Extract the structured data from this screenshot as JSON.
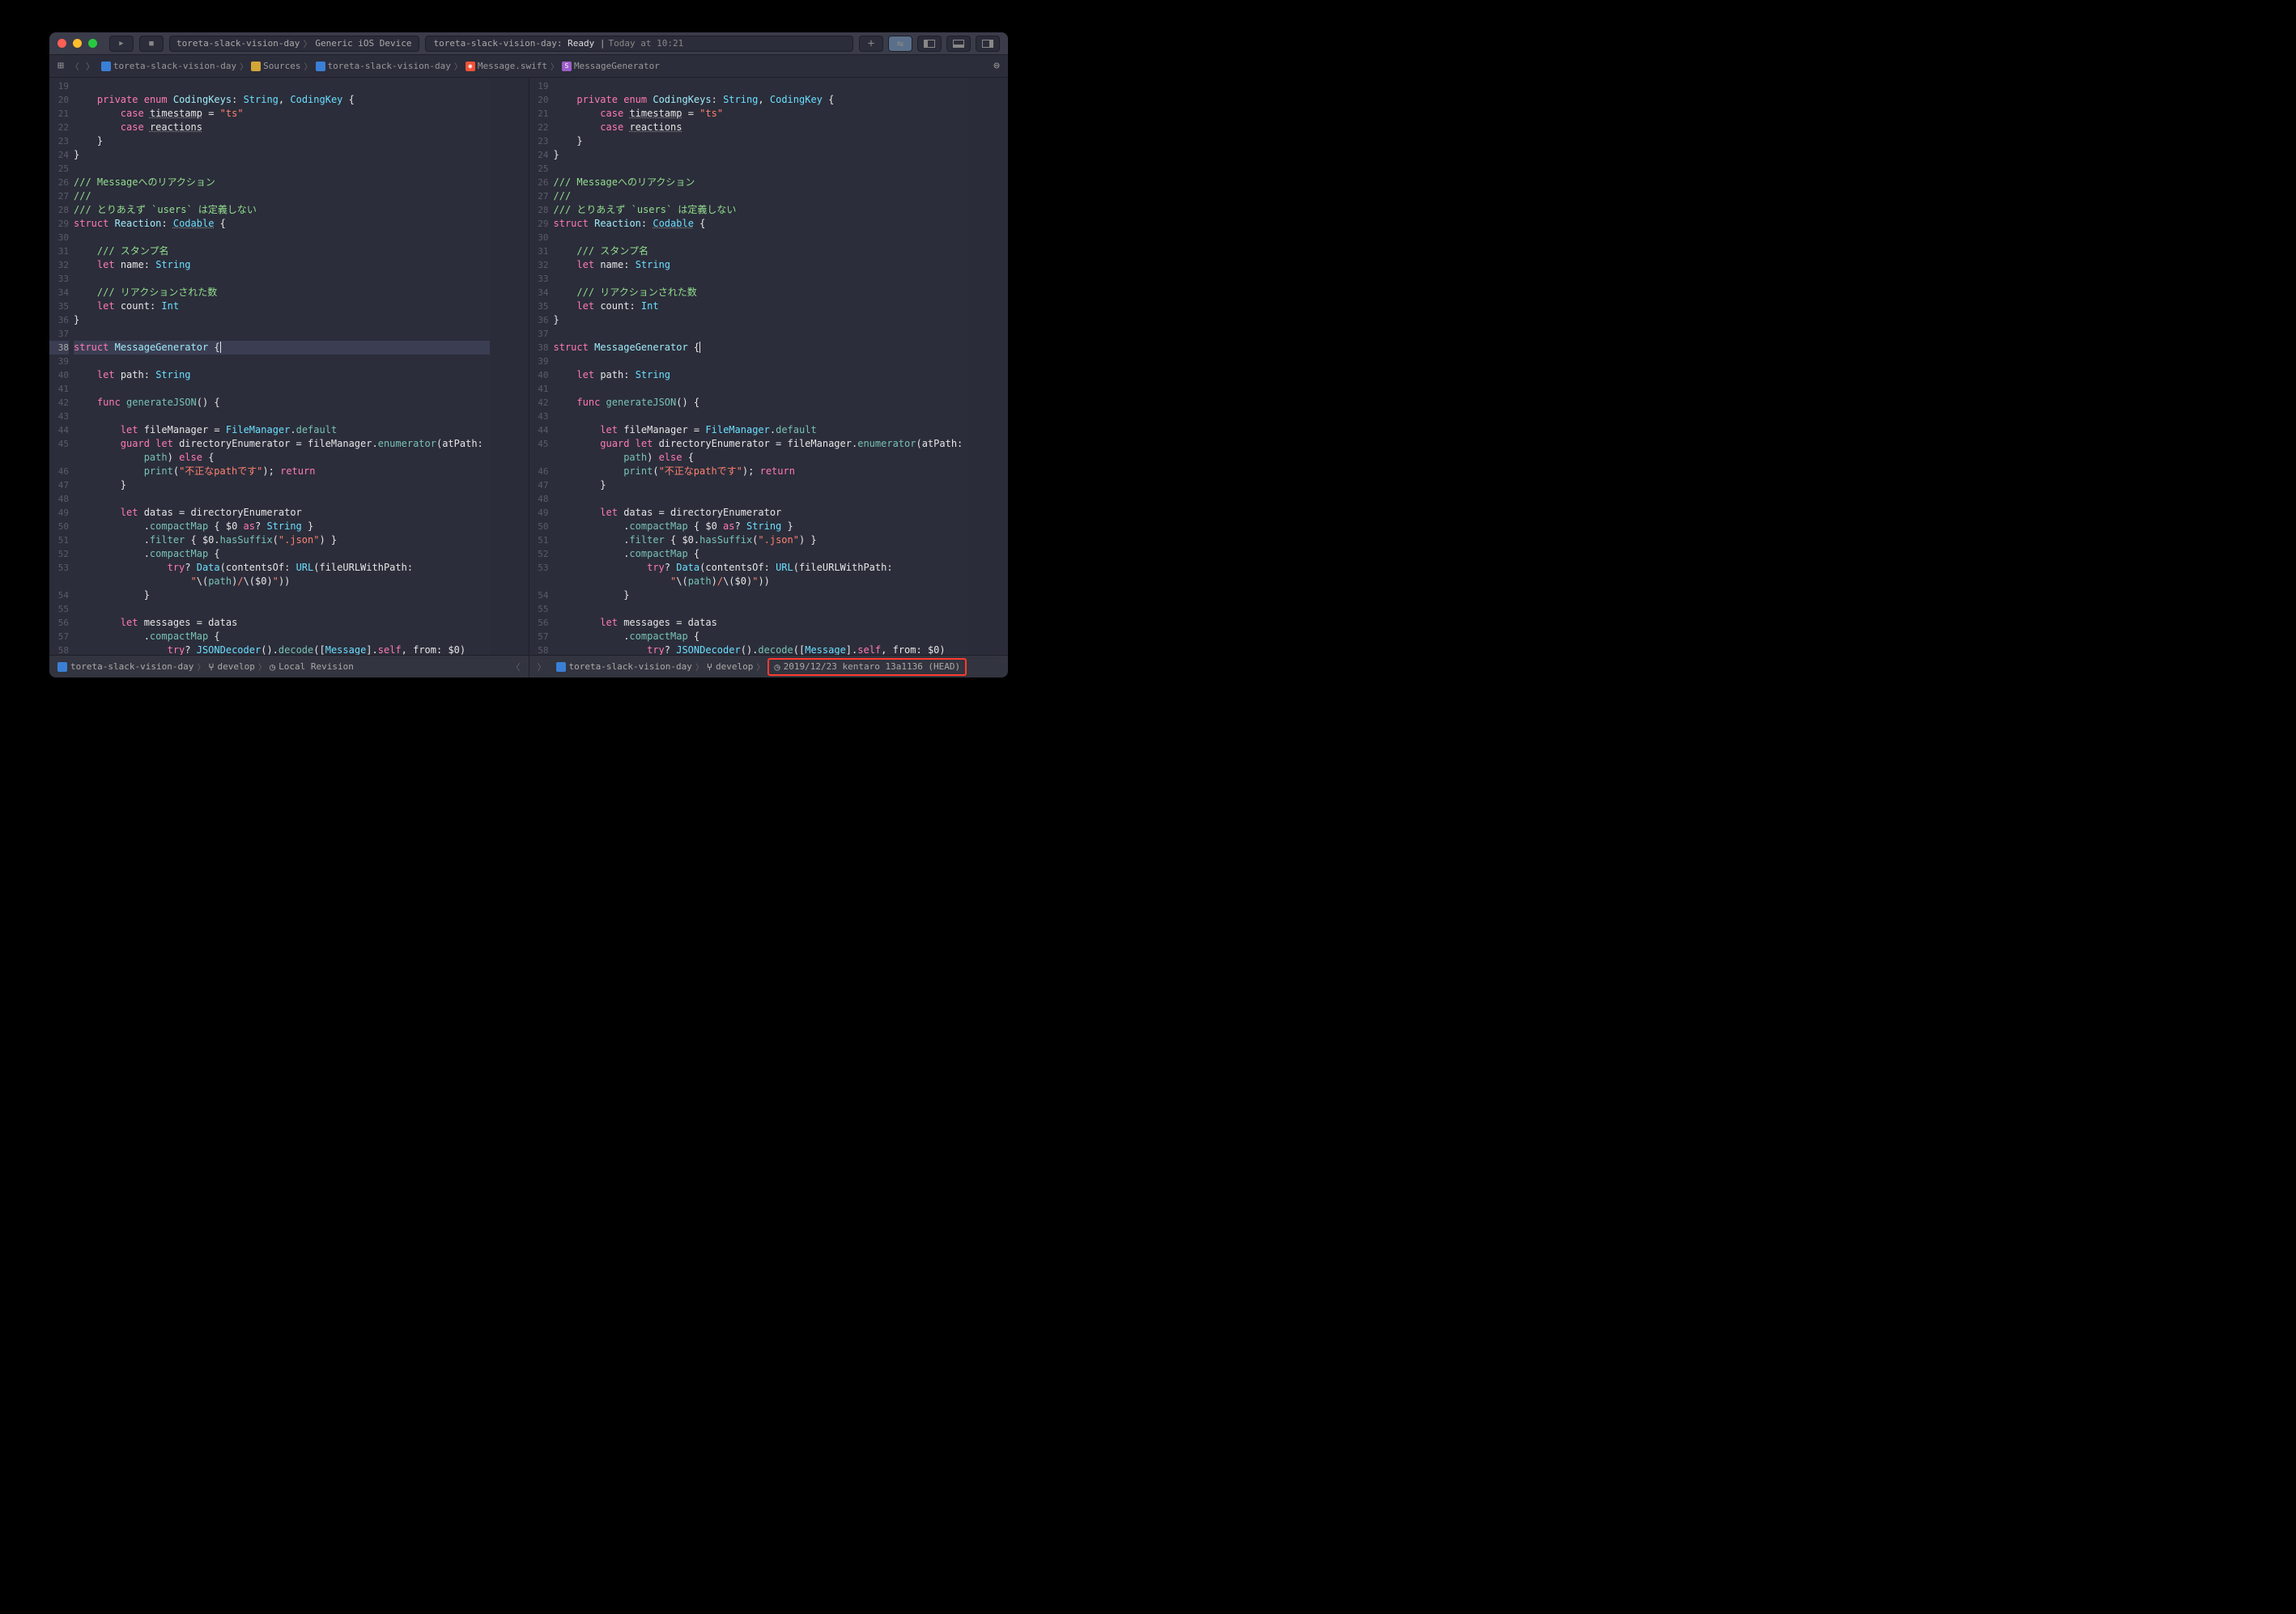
{
  "titlebar": {
    "scheme_target": "toreta-slack-vision-day",
    "scheme_device": "Generic iOS Device",
    "status_project": "toreta-slack-vision-day:",
    "status_state": "Ready",
    "status_sep": "|",
    "status_time": "Today at 10:21"
  },
  "breadcrumb": {
    "items": [
      {
        "icon": "folder",
        "label": "toreta-slack-vision-day"
      },
      {
        "icon": "folder-y",
        "label": "Sources"
      },
      {
        "icon": "folder",
        "label": "toreta-slack-vision-day"
      },
      {
        "icon": "swift",
        "label": "Message.swift"
      },
      {
        "icon": "struct",
        "label": "MessageGenerator"
      }
    ]
  },
  "code_lines": [
    {
      "n": 19,
      "tokens": []
    },
    {
      "n": 20,
      "tokens": [
        {
          "t": "    ",
          "c": "plain"
        },
        {
          "t": "private",
          "c": "kw"
        },
        {
          "t": " ",
          "c": "plain"
        },
        {
          "t": "enum",
          "c": "kw"
        },
        {
          "t": " ",
          "c": "plain"
        },
        {
          "t": "CodingKeys",
          "c": "typedef"
        },
        {
          "t": ": ",
          "c": "plain"
        },
        {
          "t": "String",
          "c": "type"
        },
        {
          "t": ", ",
          "c": "plain"
        },
        {
          "t": "CodingKey",
          "c": "type"
        },
        {
          "t": " {",
          "c": "plain"
        }
      ]
    },
    {
      "n": 21,
      "tokens": [
        {
          "t": "        ",
          "c": "plain"
        },
        {
          "t": "case",
          "c": "kw"
        },
        {
          "t": " ",
          "c": "plain"
        },
        {
          "t": "timestamp",
          "c": "plain",
          "u": true
        },
        {
          "t": " = ",
          "c": "plain"
        },
        {
          "t": "\"ts\"",
          "c": "str"
        }
      ]
    },
    {
      "n": 22,
      "tokens": [
        {
          "t": "        ",
          "c": "plain"
        },
        {
          "t": "case",
          "c": "kw"
        },
        {
          "t": " ",
          "c": "plain"
        },
        {
          "t": "reactions",
          "c": "plain",
          "u": true
        }
      ]
    },
    {
      "n": 23,
      "tokens": [
        {
          "t": "    }",
          "c": "plain"
        }
      ]
    },
    {
      "n": 24,
      "tokens": [
        {
          "t": "}",
          "c": "plain"
        }
      ]
    },
    {
      "n": 25,
      "tokens": []
    },
    {
      "n": 26,
      "tokens": [
        {
          "t": "/// Messageへのリアクション",
          "c": "doccmt"
        }
      ]
    },
    {
      "n": 27,
      "tokens": [
        {
          "t": "///",
          "c": "doccmt"
        }
      ]
    },
    {
      "n": 28,
      "tokens": [
        {
          "t": "/// とりあえず `users` は定義しない",
          "c": "doccmt"
        }
      ]
    },
    {
      "n": 29,
      "tokens": [
        {
          "t": "struct",
          "c": "kw"
        },
        {
          "t": " ",
          "c": "plain"
        },
        {
          "t": "Reaction",
          "c": "typedef"
        },
        {
          "t": ": ",
          "c": "plain"
        },
        {
          "t": "Codable",
          "c": "type",
          "u": true
        },
        {
          "t": " {",
          "c": "plain"
        }
      ]
    },
    {
      "n": 30,
      "tokens": []
    },
    {
      "n": 31,
      "tokens": [
        {
          "t": "    ",
          "c": "plain"
        },
        {
          "t": "/// スタンプ名",
          "c": "doccmt"
        }
      ]
    },
    {
      "n": 32,
      "tokens": [
        {
          "t": "    ",
          "c": "plain"
        },
        {
          "t": "let",
          "c": "kw"
        },
        {
          "t": " ",
          "c": "plain"
        },
        {
          "t": "name",
          "c": "plain"
        },
        {
          "t": ": ",
          "c": "plain"
        },
        {
          "t": "String",
          "c": "type"
        }
      ]
    },
    {
      "n": 33,
      "tokens": []
    },
    {
      "n": 34,
      "tokens": [
        {
          "t": "    ",
          "c": "plain"
        },
        {
          "t": "/// リアクションされた数",
          "c": "doccmt"
        }
      ]
    },
    {
      "n": 35,
      "tokens": [
        {
          "t": "    ",
          "c": "plain"
        },
        {
          "t": "let",
          "c": "kw"
        },
        {
          "t": " ",
          "c": "plain"
        },
        {
          "t": "count",
          "c": "plain"
        },
        {
          "t": ": ",
          "c": "plain"
        },
        {
          "t": "Int",
          "c": "type"
        }
      ]
    },
    {
      "n": 36,
      "tokens": [
        {
          "t": "}",
          "c": "plain"
        }
      ]
    },
    {
      "n": 37,
      "tokens": []
    },
    {
      "n": 38,
      "hl": true,
      "tokens": [
        {
          "t": "struct",
          "c": "kw"
        },
        {
          "t": " ",
          "c": "plain"
        },
        {
          "t": "MessageGenerator",
          "c": "typedef"
        },
        {
          "t": " {",
          "c": "plain"
        },
        {
          "t": "",
          "c": "cursor"
        }
      ]
    },
    {
      "n": 39,
      "tokens": []
    },
    {
      "n": 40,
      "tokens": [
        {
          "t": "    ",
          "c": "plain"
        },
        {
          "t": "let",
          "c": "kw"
        },
        {
          "t": " ",
          "c": "plain"
        },
        {
          "t": "path",
          "c": "plain"
        },
        {
          "t": ": ",
          "c": "plain"
        },
        {
          "t": "String",
          "c": "type"
        }
      ]
    },
    {
      "n": 41,
      "tokens": []
    },
    {
      "n": 42,
      "tokens": [
        {
          "t": "    ",
          "c": "plain"
        },
        {
          "t": "func",
          "c": "kw"
        },
        {
          "t": " ",
          "c": "plain"
        },
        {
          "t": "generateJSON",
          "c": "fn"
        },
        {
          "t": "() {",
          "c": "plain"
        }
      ]
    },
    {
      "n": 43,
      "tokens": []
    },
    {
      "n": 44,
      "tokens": [
        {
          "t": "        ",
          "c": "plain"
        },
        {
          "t": "let",
          "c": "kw"
        },
        {
          "t": " ",
          "c": "plain"
        },
        {
          "t": "fileManager",
          "c": "plain"
        },
        {
          "t": " = ",
          "c": "plain"
        },
        {
          "t": "FileManager",
          "c": "type"
        },
        {
          "t": ".",
          "c": "plain"
        },
        {
          "t": "default",
          "c": "prop"
        }
      ]
    },
    {
      "n": 45,
      "tokens": [
        {
          "t": "        ",
          "c": "plain"
        },
        {
          "t": "guard",
          "c": "kw"
        },
        {
          "t": " ",
          "c": "plain"
        },
        {
          "t": "let",
          "c": "kw"
        },
        {
          "t": " directoryEnumerator = fileManager.",
          "c": "plain"
        },
        {
          "t": "enumerator",
          "c": "fn"
        },
        {
          "t": "(atPath: ",
          "c": "plain"
        }
      ]
    },
    {
      "n": "",
      "tokens": [
        {
          "t": "            ",
          "c": "plain"
        },
        {
          "t": "path",
          "c": "prop"
        },
        {
          "t": ") ",
          "c": "plain"
        },
        {
          "t": "else",
          "c": "kw"
        },
        {
          "t": " {",
          "c": "plain"
        }
      ]
    },
    {
      "n": 46,
      "tokens": [
        {
          "t": "            ",
          "c": "plain"
        },
        {
          "t": "print",
          "c": "fn"
        },
        {
          "t": "(",
          "c": "plain"
        },
        {
          "t": "\"不正なpathです\"",
          "c": "str"
        },
        {
          "t": "); ",
          "c": "plain"
        },
        {
          "t": "return",
          "c": "kw"
        }
      ]
    },
    {
      "n": 47,
      "tokens": [
        {
          "t": "        }",
          "c": "plain"
        }
      ]
    },
    {
      "n": 48,
      "tokens": []
    },
    {
      "n": 49,
      "tokens": [
        {
          "t": "        ",
          "c": "plain"
        },
        {
          "t": "let",
          "c": "kw"
        },
        {
          "t": " datas = directoryEnumerator",
          "c": "plain"
        }
      ]
    },
    {
      "n": 50,
      "tokens": [
        {
          "t": "            .",
          "c": "plain"
        },
        {
          "t": "compactMap",
          "c": "fn"
        },
        {
          "t": " { $0 ",
          "c": "plain"
        },
        {
          "t": "as",
          "c": "kw"
        },
        {
          "t": "? ",
          "c": "plain"
        },
        {
          "t": "String",
          "c": "type"
        },
        {
          "t": " }",
          "c": "plain"
        }
      ]
    },
    {
      "n": 51,
      "tokens": [
        {
          "t": "            .",
          "c": "plain"
        },
        {
          "t": "filter",
          "c": "fn"
        },
        {
          "t": " { $0.",
          "c": "plain"
        },
        {
          "t": "hasSuffix",
          "c": "fn"
        },
        {
          "t": "(",
          "c": "plain"
        },
        {
          "t": "\".json\"",
          "c": "str"
        },
        {
          "t": ") }",
          "c": "plain"
        }
      ]
    },
    {
      "n": 52,
      "tokens": [
        {
          "t": "            .",
          "c": "plain"
        },
        {
          "t": "compactMap",
          "c": "fn"
        },
        {
          "t": " {",
          "c": "plain"
        }
      ]
    },
    {
      "n": 53,
      "tokens": [
        {
          "t": "                ",
          "c": "plain"
        },
        {
          "t": "try",
          "c": "kw"
        },
        {
          "t": "? ",
          "c": "plain"
        },
        {
          "t": "Data",
          "c": "type"
        },
        {
          "t": "(contentsOf: ",
          "c": "plain"
        },
        {
          "t": "URL",
          "c": "type"
        },
        {
          "t": "(fileURLWithPath: ",
          "c": "plain"
        }
      ]
    },
    {
      "n": "",
      "tokens": [
        {
          "t": "                    ",
          "c": "plain"
        },
        {
          "t": "\"",
          "c": "str"
        },
        {
          "t": "\\(",
          "c": "plain"
        },
        {
          "t": "path",
          "c": "prop"
        },
        {
          "t": ")",
          "c": "plain"
        },
        {
          "t": "/",
          "c": "str"
        },
        {
          "t": "\\(",
          "c": "plain"
        },
        {
          "t": "$0",
          "c": "plain"
        },
        {
          "t": ")",
          "c": "plain"
        },
        {
          "t": "\"",
          "c": "str"
        },
        {
          "t": "))",
          "c": "plain"
        }
      ]
    },
    {
      "n": 54,
      "tokens": [
        {
          "t": "            }",
          "c": "plain"
        }
      ]
    },
    {
      "n": 55,
      "tokens": []
    },
    {
      "n": 56,
      "tokens": [
        {
          "t": "        ",
          "c": "plain"
        },
        {
          "t": "let",
          "c": "kw"
        },
        {
          "t": " messages = datas",
          "c": "plain"
        }
      ]
    },
    {
      "n": 57,
      "tokens": [
        {
          "t": "            .",
          "c": "plain"
        },
        {
          "t": "compactMap",
          "c": "fn"
        },
        {
          "t": " {",
          "c": "plain"
        }
      ]
    },
    {
      "n": 58,
      "tokens": [
        {
          "t": "                ",
          "c": "plain"
        },
        {
          "t": "try",
          "c": "kw"
        },
        {
          "t": "? ",
          "c": "plain"
        },
        {
          "t": "JSONDecoder",
          "c": "type"
        },
        {
          "t": "().",
          "c": "plain"
        },
        {
          "t": "decode",
          "c": "fn"
        },
        {
          "t": "([",
          "c": "plain"
        },
        {
          "t": "Message",
          "c": "type"
        },
        {
          "t": "].",
          "c": "plain"
        },
        {
          "t": "self",
          "c": "kw"
        },
        {
          "t": ", from: $0)",
          "c": "plain"
        }
      ]
    }
  ],
  "bottombar": {
    "left": {
      "project": "toreta-slack-vision-day",
      "branch": "develop",
      "revision": "Local Revision"
    },
    "right": {
      "project": "toreta-slack-vision-day",
      "branch": "develop",
      "revision": "2019/12/23  kentaro  13a1136 (HEAD)"
    }
  }
}
